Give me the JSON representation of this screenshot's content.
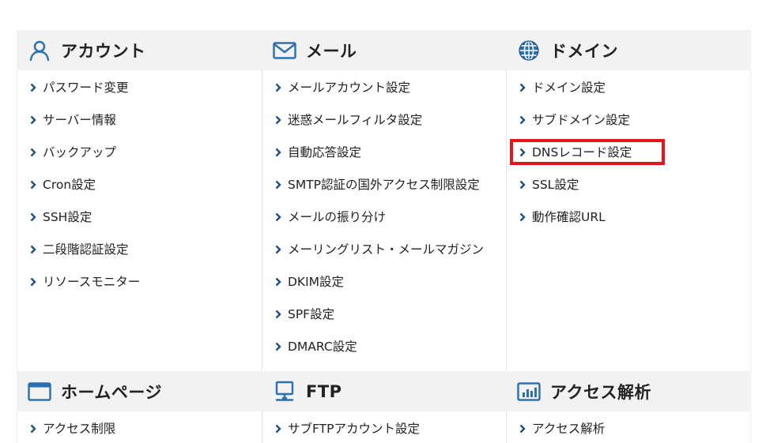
{
  "colors": {
    "icon_blue": "#2a6fb0",
    "chevron": "#1d4f80",
    "header_bg": "#f2f2f2",
    "highlight": "#e8141c"
  },
  "sections": [
    {
      "title": "アカウント",
      "icon": "user-icon",
      "items": [
        "パスワード変更",
        "サーバー情報",
        "バックアップ",
        "Cron設定",
        "SSH設定",
        "二段階認証設定",
        "リソースモニター"
      ]
    },
    {
      "title": "メール",
      "icon": "envelope-icon",
      "items": [
        "メールアカウント設定",
        "迷惑メールフィルタ設定",
        "自動応答設定",
        "SMTP認証の国外アクセス制限設定",
        "メールの振り分け",
        "メーリングリスト・メールマガジン",
        "DKIM設定",
        "SPF設定",
        "DMARC設定"
      ]
    },
    {
      "title": "ドメイン",
      "icon": "globe-icon",
      "items": [
        "ドメイン設定",
        "サブドメイン設定",
        "DNSレコード設定",
        "SSL設定",
        "動作確認URL"
      ]
    },
    {
      "title": "ホームページ",
      "icon": "browser-window-icon",
      "items": [
        "アクセス制限"
      ]
    },
    {
      "title": "FTP",
      "icon": "monitor-icon",
      "items": [
        "サブFTPアカウント設定"
      ]
    },
    {
      "title": "アクセス解析",
      "icon": "bar-chart-icon",
      "items": [
        "アクセス解析"
      ]
    }
  ]
}
